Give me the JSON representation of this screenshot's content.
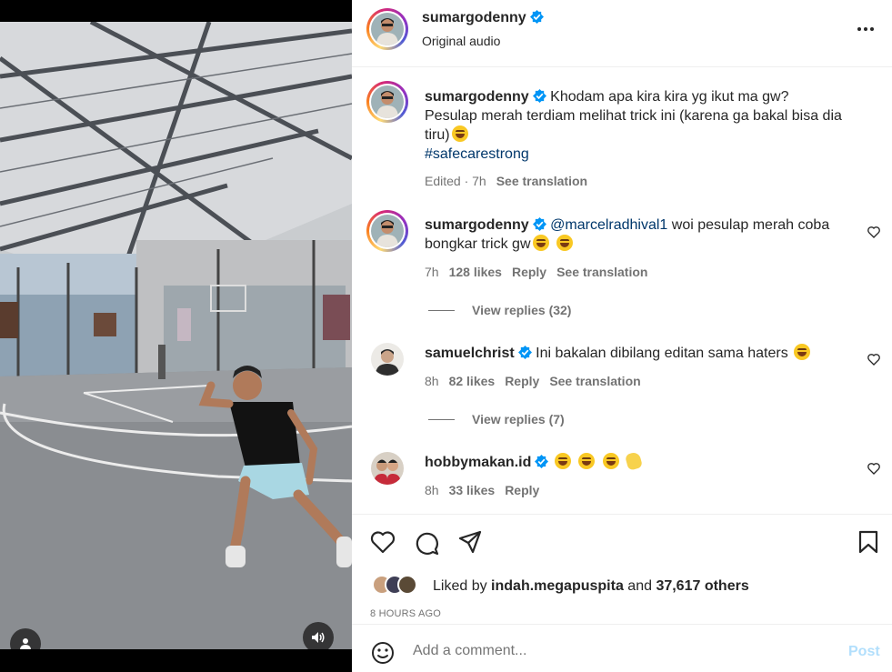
{
  "post": {
    "username": "sumargodenny",
    "audio": "Original audio",
    "caption": {
      "line1": "Khodam apa kira kira yg ikut ma gw?",
      "line2": "Pesulap merah terdiam melihat trick ini (karena ga bakal bisa dia",
      "line3": "tiru)",
      "hashtag": "#safecarestrong",
      "edited": "Edited · 7h",
      "see_translation": "See translation"
    }
  },
  "comments": [
    {
      "username": "sumargodenny",
      "mention": "@marcelradhival1",
      "text_line1": " woi pesulap merah coba",
      "text_line2": "bongkar trick gw",
      "time": "7h",
      "likes": "128 likes",
      "reply": "Reply",
      "see_translation": "See translation",
      "view_replies": "View replies (32)"
    },
    {
      "username": "samuelchrist",
      "text": "Ini bakalan dibilang editan sama haters",
      "time": "8h",
      "likes": "82 likes",
      "reply": "Reply",
      "see_translation": "See translation",
      "view_replies": "View replies (7)"
    },
    {
      "username": "hobbymakan.id",
      "time": "8h",
      "likes": "33 likes",
      "reply": "Reply"
    }
  ],
  "likes": {
    "prefix": "Liked by ",
    "user": "indah.megapuspita",
    "and": " and ",
    "others": "37,617 others"
  },
  "timestamp": "8 HOURS AGO",
  "comment_input": {
    "placeholder": "Add a comment...",
    "post_label": "Post"
  },
  "icons": {
    "more": "more-options-icon",
    "like": "heart-icon",
    "comment": "comment-icon",
    "share": "share-icon",
    "save": "bookmark-icon",
    "emoji": "emoji-icon",
    "verified": "verified-badge-icon"
  },
  "colors": {
    "verified": "#0095f6",
    "link": "#00376b",
    "post_disabled": "#b2dffc",
    "muted": "#737373"
  }
}
